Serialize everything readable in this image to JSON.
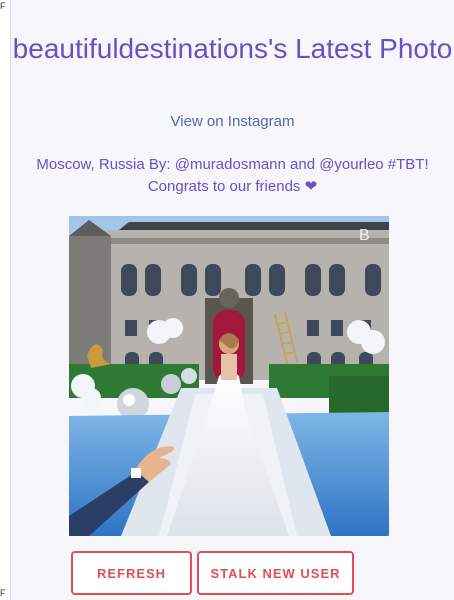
{
  "page": {
    "title": "beautifuldestinations's Latest Photo",
    "instagram_link": "View on Instagram",
    "caption": "Moscow, Russia By: @muradosmann and @yourleo #TBT! Congrats to our friends",
    "caption_heart": "❤"
  },
  "edge": {
    "glyph_top": "F",
    "glyph_bottom": "F"
  },
  "photo": {
    "watermark": "B"
  },
  "buttons": {
    "refresh_label": "REFRESH",
    "stalk_label": "STALK NEW USER"
  },
  "colors": {
    "title": "#6b4fc4",
    "link": "#4e6aa8",
    "button_accent": "#e04e5a",
    "background": "#f7f7fb"
  }
}
